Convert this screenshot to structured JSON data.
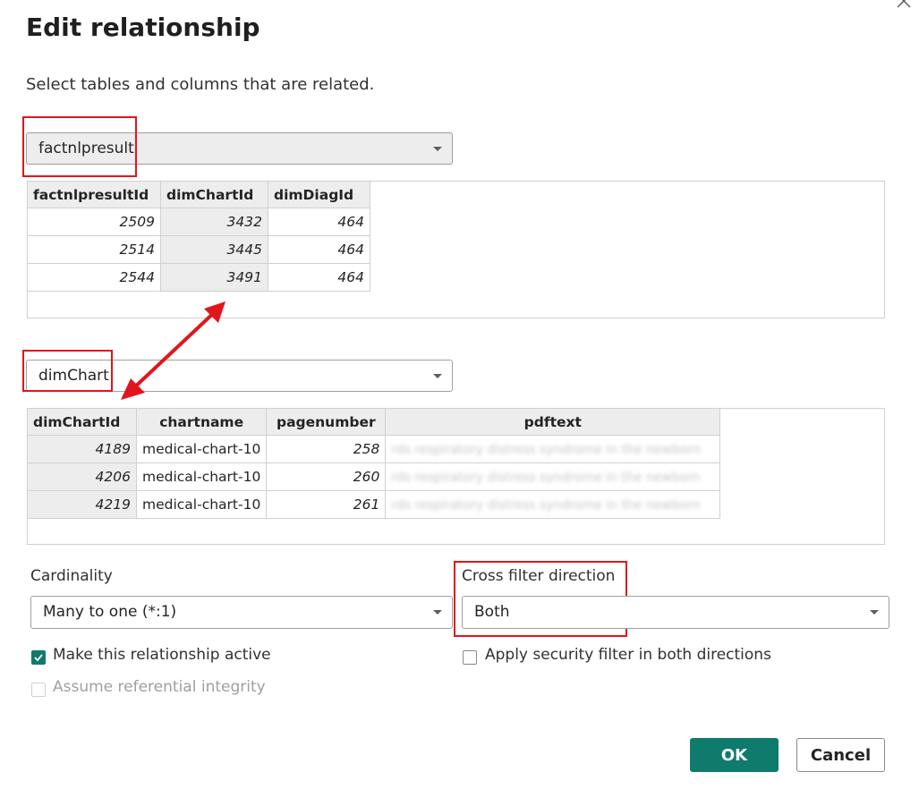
{
  "dialog": {
    "title": "Edit relationship",
    "subtitle": "Select tables and columns that are related."
  },
  "table1": {
    "selected": "factnlpresult",
    "columns": [
      "factnlpresultId",
      "dimChartId",
      "dimDiagId"
    ],
    "rows": [
      [
        "2509",
        "3432",
        "464"
      ],
      [
        "2514",
        "3445",
        "464"
      ],
      [
        "2544",
        "3491",
        "464"
      ]
    ]
  },
  "table2": {
    "selected": "dimChart",
    "columns": [
      "dimChartId",
      "chartname",
      "pagenumber",
      "pdftext"
    ],
    "rows": [
      [
        "4189",
        "medical-chart-10",
        "258",
        "rds respiratory distress syndrome in the newborn"
      ],
      [
        "4206",
        "medical-chart-10",
        "260",
        "rds respiratory distress syndrome in the newborn"
      ],
      [
        "4219",
        "medical-chart-10",
        "261",
        "rds respiratory distress syndrome in the newborn"
      ]
    ]
  },
  "cardinality": {
    "label": "Cardinality",
    "value": "Many to one (*:1)"
  },
  "cross_filter": {
    "label": "Cross filter direction",
    "value": "Both"
  },
  "options": {
    "active": "Make this relationship active",
    "referential": "Assume referential integrity",
    "security": "Apply security filter in both directions"
  },
  "buttons": {
    "ok": "OK",
    "cancel": "Cancel"
  },
  "colors": {
    "accent": "#0f7b6c",
    "highlight": "#e0161c"
  }
}
